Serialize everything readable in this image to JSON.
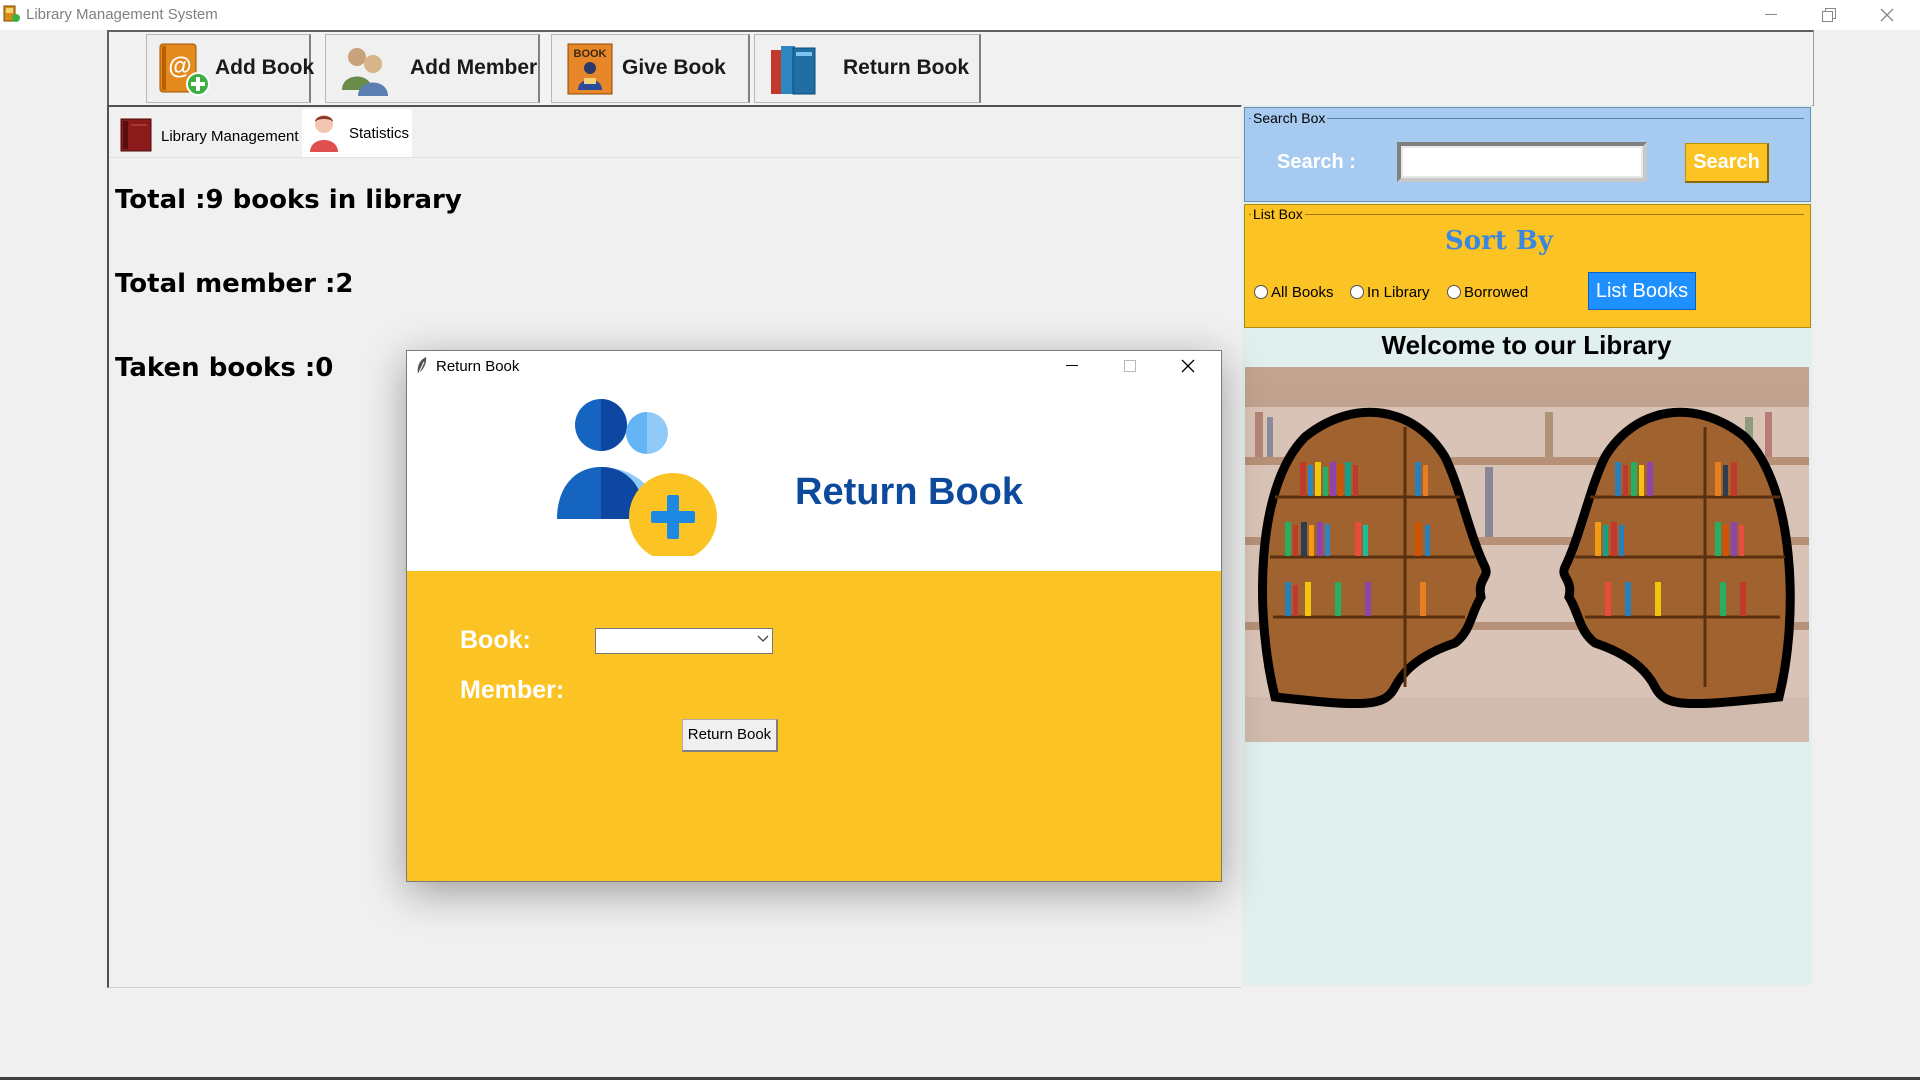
{
  "window": {
    "title": "Library Management System"
  },
  "toolbar": {
    "buttons": [
      {
        "label": "Add Book",
        "icon": "address-book-add-icon"
      },
      {
        "label": "Add Member",
        "icon": "users-icon"
      },
      {
        "label": "Give Book",
        "icon": "book-reader-icon"
      },
      {
        "label": "Return Book",
        "icon": "books-icon"
      }
    ]
  },
  "tabs": [
    {
      "label": "Library Management",
      "icon": "book-icon"
    },
    {
      "label": "Statistics",
      "icon": "person-icon"
    }
  ],
  "stats": {
    "total_books": "Total :9 books in library",
    "total_members": "Total member :2",
    "taken_books": "Taken books :0"
  },
  "search_box": {
    "legend": "Search Box",
    "label": "Search :",
    "input_value": "",
    "button_label": "Search"
  },
  "list_box": {
    "legend": "List Box",
    "sort_title": "Sort By",
    "options": [
      "All Books",
      "In Library",
      "Borrowed"
    ],
    "button_label": "List Books"
  },
  "welcome": {
    "text": "Welcome to our Library"
  },
  "dialog": {
    "title": "Return Book",
    "heading": "Return Book",
    "book_label": "Book:",
    "book_value": "",
    "member_label": "Member:",
    "button_label": "Return Book"
  },
  "colors": {
    "accent_yellow": "#fbc324",
    "search_blue": "#a6caf0",
    "heading_blue": "#0d4a9e",
    "list_button_blue": "#1e90ff",
    "sort_title_blue": "#3a86e0"
  }
}
